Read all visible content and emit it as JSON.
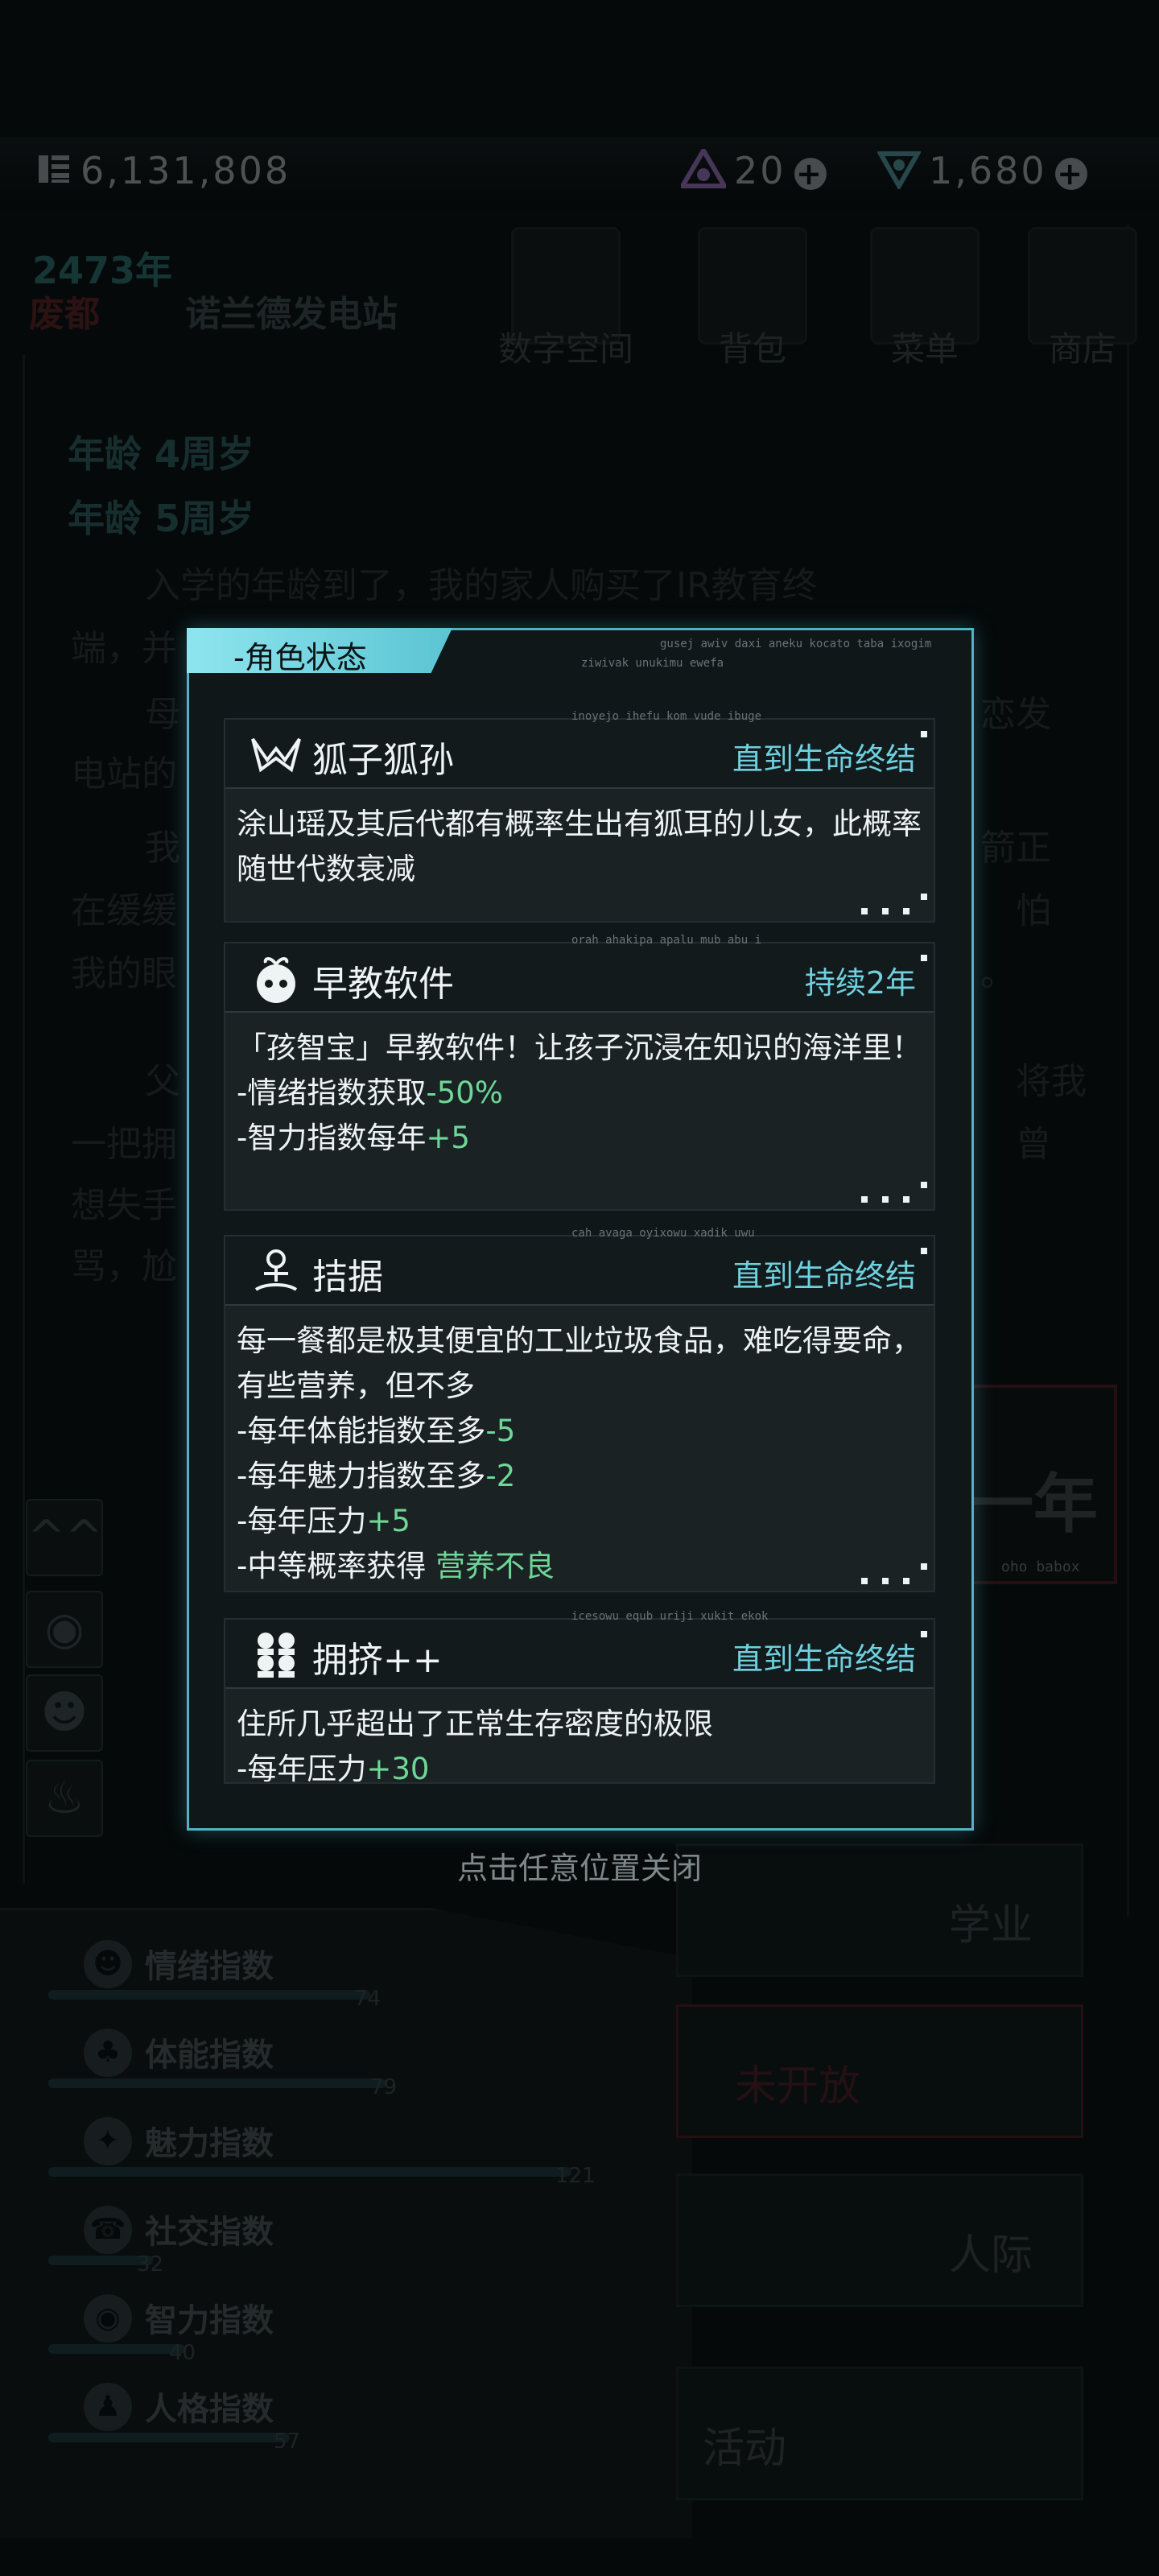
{
  "currency": {
    "coins": "6,131,808",
    "gems": "20",
    "crystals": "1,680"
  },
  "header": {
    "year": "2473年",
    "city": "废都",
    "place": "诺兰德发电站"
  },
  "nav": [
    {
      "label": "数字空间"
    },
    {
      "label": "背包"
    },
    {
      "label": "菜单"
    },
    {
      "label": "商店"
    }
  ],
  "story": {
    "age1": "年龄 4周岁",
    "age2": "年龄 5周岁",
    "line1": "入学的年龄到了，我的家人购买了IR教育终",
    "line2": "端，并",
    "line3": "母",
    "line3b": "恋发",
    "line4": "电站的",
    "line5": "我",
    "line5b": "箭正",
    "line6": "在缓缓",
    "line6b": "怕",
    "line7": "我的眼",
    "line7b": "。",
    "line8": "父",
    "line8b": "将我",
    "line9": "一把拥",
    "line9b": "曾",
    "line10": "想失手",
    "line11": "骂，尬"
  },
  "background_right": {
    "year_btn": "一年",
    "year_sub": "oho babox",
    "edu": "学业",
    "closed": "未开放",
    "social": "人际",
    "activity": "活动"
  },
  "stats": [
    {
      "name": "情绪指数",
      "value": "74",
      "fill": 0.4
    },
    {
      "name": "体能指数",
      "value": "79",
      "fill": 0.42
    },
    {
      "name": "魅力指数",
      "value": "121",
      "fill": 0.65
    },
    {
      "name": "社交指数",
      "value": "32",
      "fill": 0.13
    },
    {
      "name": "智力指数",
      "value": "40",
      "fill": 0.17
    },
    {
      "name": "人格指数",
      "value": "57",
      "fill": 0.3
    }
  ],
  "dialog": {
    "title": "-角色状态",
    "code1": "gusej awiv daxi aneku kocato taba ixogim",
    "code2": "ziwivak unukimu ewefa",
    "close_hint": "点击任意位置关闭",
    "cards": [
      {
        "icon": "fox-ears-icon",
        "name": "狐子狐孙",
        "duration": "直到生命终结",
        "code": "inoyejo ihefu kom vude ibuge",
        "desc": "涂山瑶及其后代都有概率生出有狐耳的儿女，此概率随世代数衰减",
        "effects": []
      },
      {
        "icon": "sprout-face-icon",
        "name": "早教软件",
        "duration": "持续2年",
        "code": "orah ahakipa apalu mub abu i",
        "desc": "「孩智宝」早教软件！让孩子沉浸在知识的海洋里！",
        "effects": [
          {
            "text": "-情绪指数获取",
            "value": "-50%"
          },
          {
            "text": "-智力指数每年",
            "value": "+5"
          }
        ]
      },
      {
        "icon": "struggle-icon",
        "name": "拮据",
        "duration": "直到生命终结",
        "code": "cah avaga oyixowu xadik uwu",
        "desc": "每一餐都是极其便宜的工业垃圾食品，难吃得要命，有些营养，但不多",
        "effects": [
          {
            "text": "-每年体能指数至多",
            "value": "-5"
          },
          {
            "text": "-每年魅力指数至多",
            "value": "-2"
          },
          {
            "text": "-每年压力",
            "value": "+5"
          },
          {
            "text": "-中等概率获得 ",
            "value": "营养不良"
          }
        ]
      },
      {
        "icon": "crowd-icon",
        "name": "拥挤++",
        "duration": "直到生命终结",
        "code": "icesowu equb uriji xukit ekok",
        "desc": "住所几乎超出了正常生存密度的极限",
        "effects": [
          {
            "text": "-每年压力",
            "value": "+30"
          }
        ]
      }
    ]
  }
}
